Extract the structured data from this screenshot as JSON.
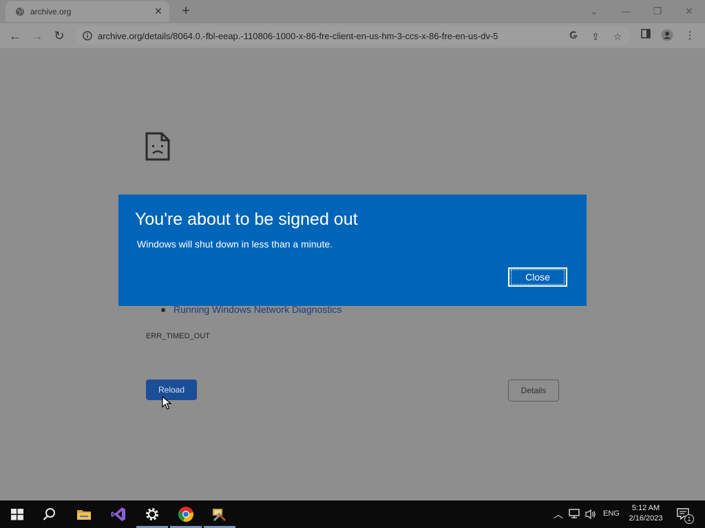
{
  "browser": {
    "tab_title": "archive.org",
    "url": "archive.org/details/8064.0.-fbl-eeap.-110806-1000-x-86-fre-client-en-us-hm-3-ccs-x-86-fre-en-us-dv-5",
    "tab_close": "✕",
    "new_tab": "+",
    "window_controls": {
      "dropdown": "⌄",
      "minimize": "—",
      "restore": "❐",
      "close": "✕"
    }
  },
  "error_page": {
    "link_text": "Running Windows Network Diagnostics",
    "error_code": "ERR_TIMED_OUT",
    "reload_label": "Reload",
    "details_label": "Details"
  },
  "dialog": {
    "title": "You're about to be signed out",
    "message": "Windows will shut down in less than a minute.",
    "close_label": "Close"
  },
  "taskbar": {
    "language": "ENG",
    "time": "5:12 AM",
    "date": "2/16/2023",
    "notification_count": "1",
    "pinned_apps": [
      "start-icon",
      "search-icon",
      "file-explorer-icon",
      "visual-studio-icon",
      "settings-icon",
      "chrome-icon",
      "tools-app-icon"
    ]
  },
  "colors": {
    "dialog_bg": "#0065b8",
    "reload_bg": "#1b4e96",
    "page_overlay": "#8e8e8e"
  }
}
